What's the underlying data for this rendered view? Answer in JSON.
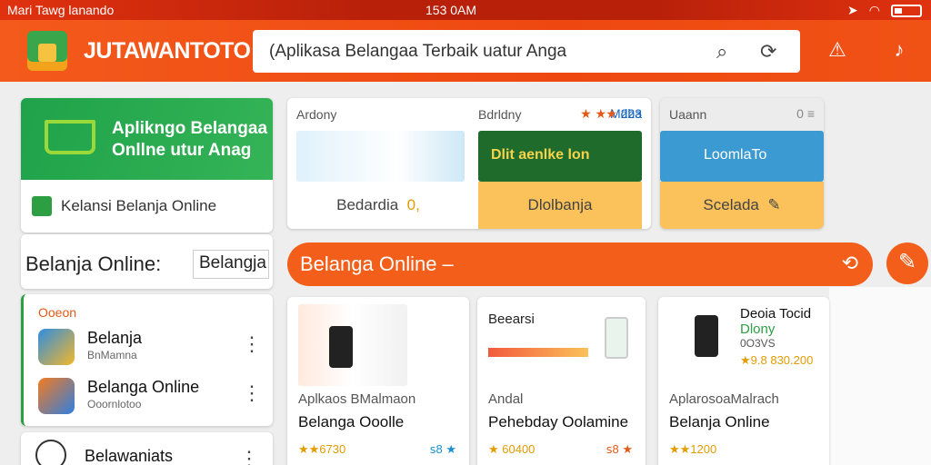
{
  "status": {
    "carrier": "Mari Tawg lanando",
    "time": "153 0AM"
  },
  "header": {
    "brand": "JUTAWANTOTO",
    "search_placeholder": "(Aplikasa Belangaa Terbaik uatur Anga",
    "search_icon": "search-icon",
    "scan_icon": "scan-icon",
    "alert_icon": "alert-icon",
    "mic_icon": "mic-icon"
  },
  "promo": {
    "banner_text": "Aplikngo Belangaa Onllne utur Anag",
    "footer_text": "Kelansi Belanja Online"
  },
  "tiles": [
    {
      "head": "Ardony",
      "badge": "Mdba",
      "label": "Bedardia",
      "tag": "0,"
    },
    {
      "head": "Bdrldny",
      "badge": "223",
      "label": "Dlolbanja",
      "banner": "Dlit aenlke lon"
    },
    {
      "head": "Uaann",
      "badge": "0",
      "label": "Scelada",
      "banner": "LoomlaTo"
    }
  ],
  "side": {
    "title": "Belanja Online:",
    "box": "Belangja",
    "section": "Ooeon",
    "items": [
      {
        "title": "Belanja",
        "subtitle": "BnMamna"
      },
      {
        "title": "Belanga Online",
        "subtitle": "Ooornlotoo"
      },
      {
        "title": "Belawaniats",
        "subtitle": ""
      }
    ]
  },
  "banner": {
    "text": "Belanga Online –"
  },
  "products": [
    {
      "sub": "Aplkaos BMalmaon",
      "name": "Belanga Ooolle",
      "rating": "★★6730",
      "right": "ꜱ8 ★"
    },
    {
      "head": "Beearsi",
      "sub": "Andal",
      "name": "Pehebday Oolamine",
      "rating": "★ 60400",
      "right": "ꜱ8 ★"
    },
    {
      "head": "Deoia Tocid",
      "head2": "Dlony",
      "head3": "0O3VS",
      "head4": "★9.8 830.200",
      "sub": "AplarosoaMalrach",
      "name": "Belanja Online",
      "rating": "★★1200"
    }
  ],
  "colors": {
    "orange": "#f05216",
    "green": "#2e9e42",
    "yellow": "#fbc15a"
  }
}
